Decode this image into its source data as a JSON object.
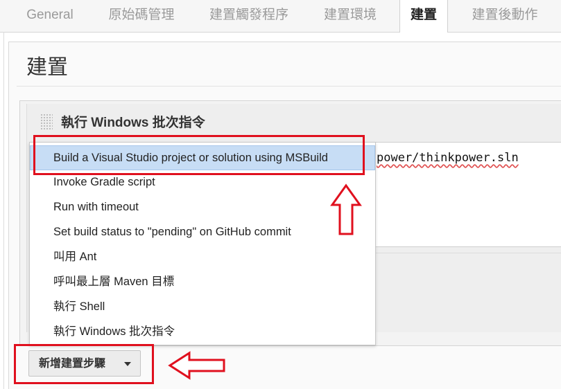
{
  "tabs": [
    {
      "label": "General",
      "active": false
    },
    {
      "label": "原始碼管理",
      "active": false
    },
    {
      "label": "建置觸發程序",
      "active": false
    },
    {
      "label": "建置環境",
      "active": false
    },
    {
      "label": "建置",
      "active": true
    },
    {
      "label": "建置後動作",
      "active": false
    }
  ],
  "section_title": "建置",
  "build_step": {
    "title": "執行 Windows 批次指令",
    "command_visible": "power/thinkpower.sln"
  },
  "menu": {
    "items": [
      "Build a Visual Studio project or solution using MSBuild",
      "Invoke Gradle script",
      "Run with timeout",
      "Set build status to \"pending\" on GitHub commit",
      "叫用 Ant",
      "呼叫最上層 Maven 目標",
      "執行 Shell",
      "執行 Windows 批次指令"
    ],
    "highlighted_index": 0
  },
  "add_step_button": {
    "label": "新增建置步驟",
    "icon": "caret-down-icon"
  },
  "annotation": {
    "color": "#e0101e",
    "icons": [
      "arrow-up-icon",
      "arrow-left-icon"
    ]
  }
}
